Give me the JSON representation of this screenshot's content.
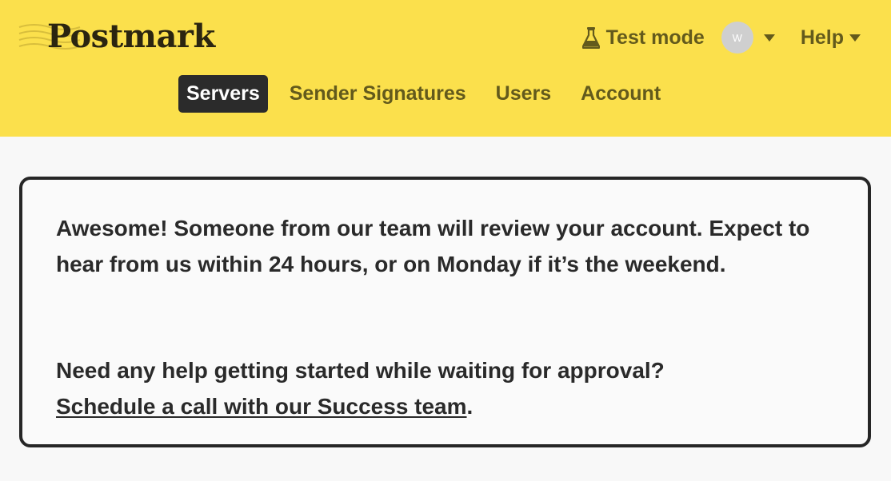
{
  "header": {
    "logo_text": "Postmark",
    "test_mode_label": "Test mode",
    "avatar_initial": "W",
    "help_label": "Help"
  },
  "nav": {
    "items": [
      {
        "label": "Servers",
        "active": true
      },
      {
        "label": "Sender Signatures",
        "active": false
      },
      {
        "label": "Users",
        "active": false
      },
      {
        "label": "Account",
        "active": false
      }
    ]
  },
  "notice": {
    "message": "Awesome! Someone from our team will review your account. Expect to hear from us within 24 hours, or on Monday if it’s the weekend.",
    "help_question": "Need any help getting started while waiting for approval?",
    "link_text": "Schedule a call with our Success team",
    "link_suffix": "."
  },
  "colors": {
    "header_bg": "#fbe04c",
    "nav_text": "#635a1c",
    "active_tab_bg": "#2b2b2b",
    "card_border": "#262626",
    "page_bg": "#f8f8f8"
  },
  "icons": [
    "postmark-logo-icon",
    "flask-icon",
    "chevron-down-icon"
  ]
}
